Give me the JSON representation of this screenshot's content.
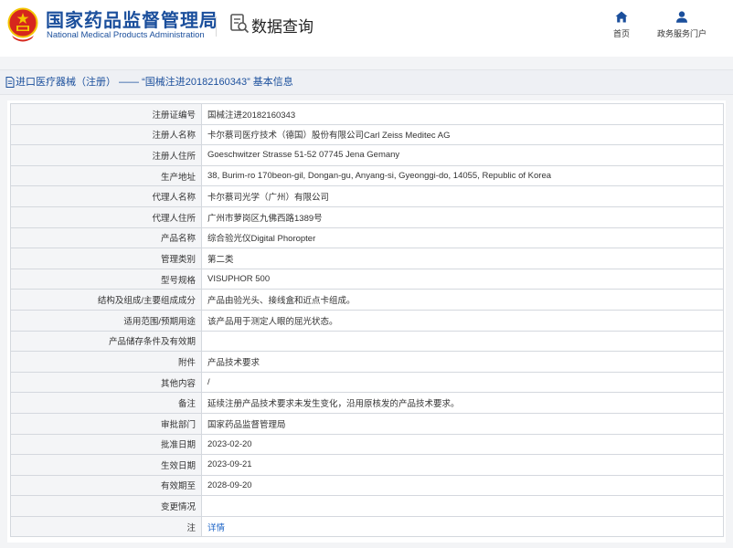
{
  "header": {
    "brand_cn": "国家药品监督管理局",
    "brand_en": "National Medical Products Administration",
    "query_title": "数据查询",
    "nav": [
      {
        "label": "首页",
        "icon": "home-icon"
      },
      {
        "label": "政务服务门户",
        "icon": "user-icon"
      }
    ]
  },
  "breadcrumb": {
    "text": "进口医疗器械（注册） —— “国械注进20182160343” 基本信息"
  },
  "colors": {
    "brand_blue": "#1b4f9c",
    "emblem_red": "#d6261d",
    "emblem_gold": "#f3c500",
    "link_blue": "#1b63c6"
  },
  "table": {
    "rows": [
      {
        "label": "注册证编号",
        "value": "国械注进20182160343"
      },
      {
        "label": "注册人名称",
        "value": "卡尔蔡司医疗技术（德国）股份有限公司Carl Zeiss Meditec AG"
      },
      {
        "label": "注册人住所",
        "value": "Goeschwitzer Strasse 51-52 07745 Jena Gemany"
      },
      {
        "label": "生产地址",
        "value": "38, Burim-ro 170beon-gil, Dongan-gu, Anyang-si, Gyeonggi-do, 14055, Republic of Korea"
      },
      {
        "label": "代理人名称",
        "value": "卡尔蔡司光学（广州）有限公司"
      },
      {
        "label": "代理人住所",
        "value": "广州市萝岗区九佛西路1389号"
      },
      {
        "label": "产品名称",
        "value": "综合验光仪Digital Phoropter"
      },
      {
        "label": "管理类别",
        "value": "第二类"
      },
      {
        "label": "型号规格",
        "value": "VISUPHOR 500"
      },
      {
        "label": "结构及组成/主要组成成分",
        "value": "产品由验光头、接线盒和近点卡组成。"
      },
      {
        "label": "适用范围/预期用途",
        "value": "该产品用于测定人眼的屈光状态。"
      },
      {
        "label": "产品储存条件及有效期",
        "value": ""
      },
      {
        "label": "附件",
        "value": "产品技术要求"
      },
      {
        "label": "其他内容",
        "value": "/"
      },
      {
        "label": "备注",
        "value": "延续注册产品技术要求未发生变化，沿用原核发的产品技术要求。"
      },
      {
        "label": "审批部门",
        "value": "国家药品监督管理局"
      },
      {
        "label": "批准日期",
        "value": "2023-02-20"
      },
      {
        "label": "生效日期",
        "value": "2023-09-21"
      },
      {
        "label": "有效期至",
        "value": "2028-09-20"
      },
      {
        "label": "变更情况",
        "value": ""
      },
      {
        "label": "注",
        "value": "详情",
        "link": true
      }
    ]
  }
}
